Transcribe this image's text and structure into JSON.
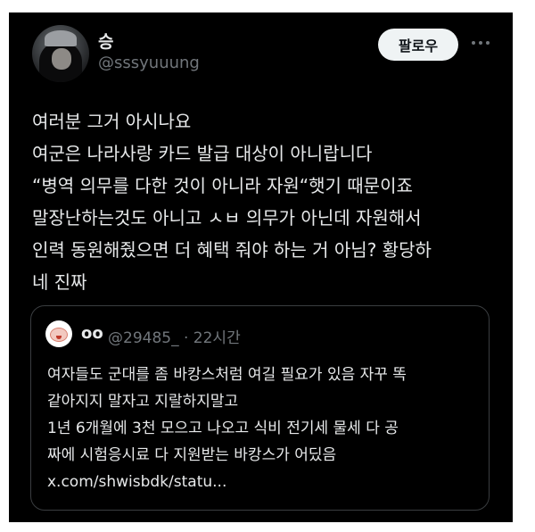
{
  "tweet": {
    "author_name": "승",
    "author_handle": "@sssyuuung",
    "follow_label": "팔로우",
    "more_icon": "more-horizontal-icon",
    "text_lines": [
      "여러분 그거 아시나요",
      "여군은 나라사랑 카드 발급 대상이 아니랍니다",
      "“병역 의무를 다한 것이 아니라 자원“햇기 때문이죠",
      "말장난하는것도 아니고 ㅅㅂ 의무가 아닌데 자원해서",
      "인력 동원해줬으면 더 혜택 줘야 하는 거 아님? 황당하",
      "네 진짜"
    ]
  },
  "quoted": {
    "author_name": "oo",
    "meta": "@29485_ · 22시간",
    "text_lines": [
      "여자들도 군대를 좀 바캉스처럼 여길 필요가 있음 자꾸 똑",
      "같아지지 말자고 지랄하지말고",
      "1년 6개월에 3천 모으고 나오고 식비 전기세 물세 다 공",
      "짜에 시험응시료 다 지원받는 바캉스가 어딨음",
      "x.com/shwisbdk/statu..."
    ]
  },
  "colors": {
    "background": "#000000",
    "text": "#e7e9ea",
    "muted": "#71767b",
    "follow_button": "#eff3f4"
  }
}
